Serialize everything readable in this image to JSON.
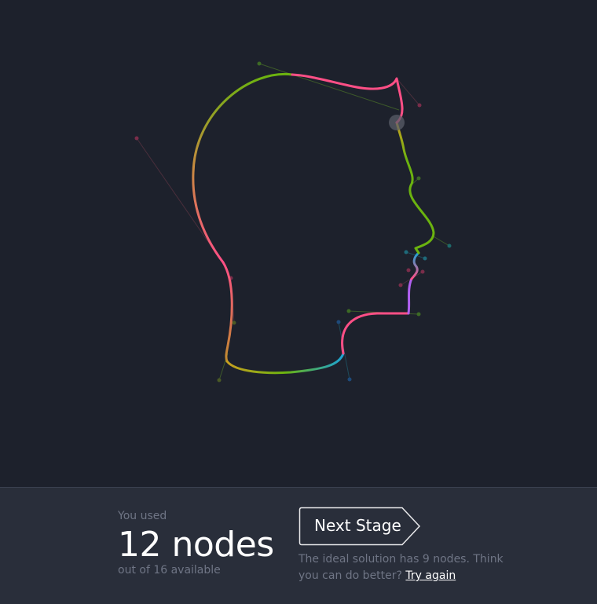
{
  "colors": {
    "background": "#1d212c",
    "footer_background": "#292e3a",
    "curve_pink": "#ff4f86",
    "curve_green": "#6bb30f",
    "curve_cyan": "#1ca3d6",
    "curve_purple": "#b060f0"
  },
  "stats": {
    "label_top": "You used",
    "count_text": "12 nodes",
    "label_bottom": "out of 16 available"
  },
  "next_stage": {
    "label": "Next Stage"
  },
  "hint": {
    "text": "The ideal solution has 9 nodes. Think you can do better?",
    "try_again_label": "Try again"
  },
  "icons": {
    "active_node": "node-handle-icon",
    "next_arrow": "arrow-tag-icon"
  }
}
